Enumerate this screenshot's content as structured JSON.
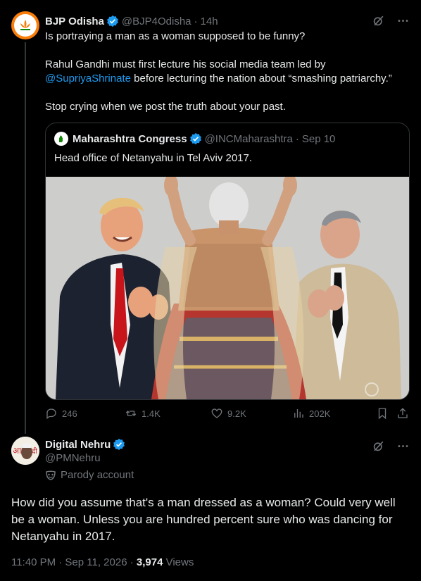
{
  "tweet": {
    "author_name": "BJP Odisha",
    "handle": "@BJP4Odisha",
    "time": "14h",
    "lines": [
      "Is portraying a man as a woman supposed to be funny?",
      "Rahul Gandhi must first lecture his social media team led by",
      "@SupriyaShrinate",
      " before lecturing the nation about “smashing patriarchy.”",
      "Stop crying when we post the truth about your past."
    ],
    "quote": {
      "author_name": "Maharashtra Congress",
      "handle": "@INCMaharashtra",
      "date": "Sep 10",
      "text": "Head office of Netanyahu in Tel Aviv 2017."
    },
    "stats": {
      "replies": "246",
      "reposts": "1.4K",
      "likes": "9.2K",
      "views": "202K"
    }
  },
  "reply": {
    "author_name": "Digital Nehru",
    "handle": "@PMNehru",
    "label": "Parody account",
    "text": "How did you assume that's a man dressed as a woman? Could very well be a woman. Unless you are hundred percent sure who was dancing for Netanyahu in 2017.",
    "timestamp": "11:40 PM · Sep 11, 2026 · ",
    "views_count": "3,974",
    "views_label": " Views"
  },
  "icons": [
    "grok-icon",
    "more-icon",
    "verified-badge-icon",
    "reply-icon",
    "repost-icon",
    "like-icon",
    "views-icon",
    "bookmark-icon",
    "share-icon",
    "parody-mask-icon"
  ],
  "colors": {
    "accent": "#1d9bf0",
    "muted": "#71767b",
    "text": "#e7e9ea",
    "border": "#2f3336",
    "background": "#000000"
  }
}
